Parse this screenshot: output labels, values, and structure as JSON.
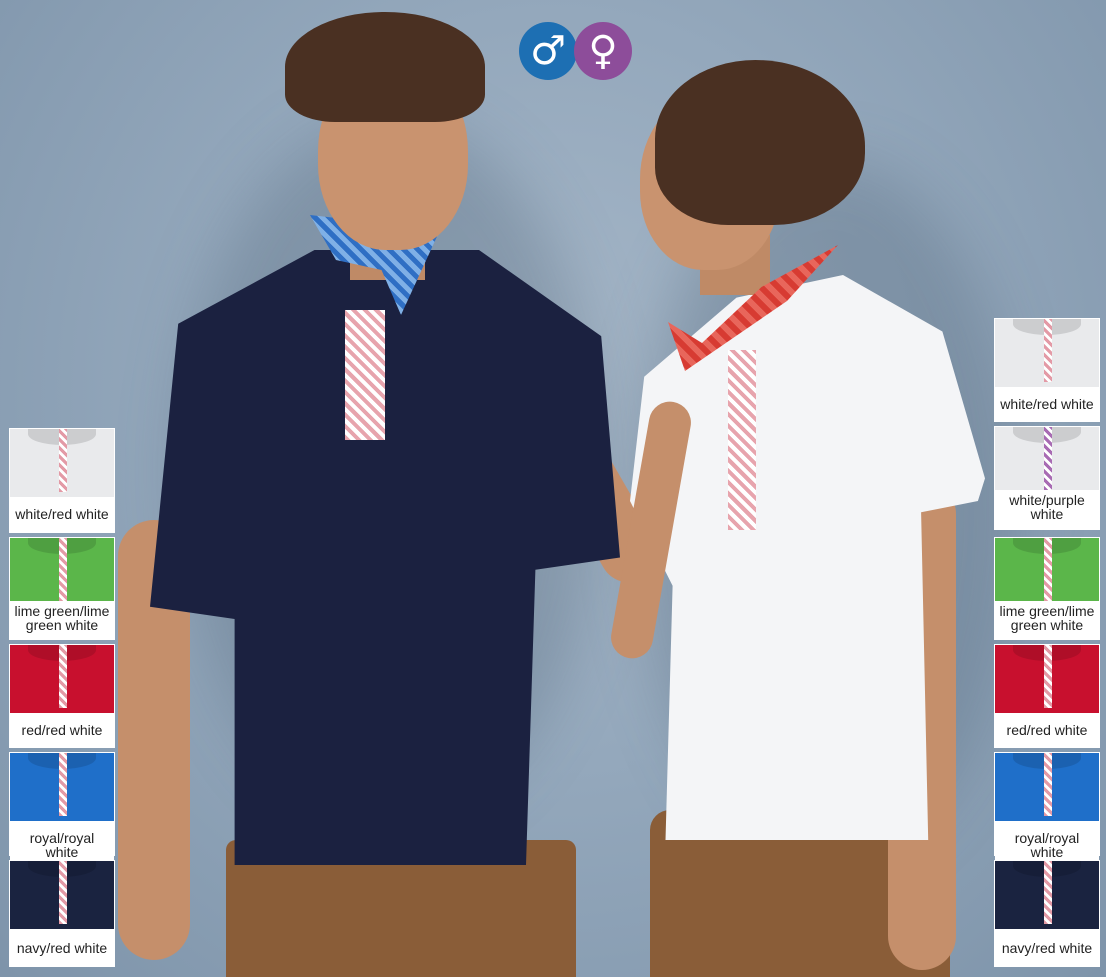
{
  "gender_icons": [
    {
      "name": "male-icon",
      "glyph": "♂",
      "color": "#1d6fb3"
    },
    {
      "name": "female-icon",
      "glyph": "♀",
      "color": "#8d4d9a"
    }
  ],
  "left_swatches": [
    {
      "label": "white/red white",
      "color": "#e9eaec"
    },
    {
      "label": "lime green/lime green white",
      "color": "#5bb64a"
    },
    {
      "label": "red/red white",
      "color": "#c8102e"
    },
    {
      "label": "royal/royal white",
      "color": "#1f6fc9"
    },
    {
      "label": "navy/red white",
      "color": "#1a2340"
    }
  ],
  "right_swatches": [
    {
      "label": "white/red white",
      "color": "#e9eaec"
    },
    {
      "label": "white/purple white",
      "color": "#e9eaec"
    },
    {
      "label": "lime green/lime green white",
      "color": "#5bb64a"
    },
    {
      "label": "red/red white",
      "color": "#c8102e"
    },
    {
      "label": "royal/royal white",
      "color": "#1f6fc9"
    },
    {
      "label": "navy/red white",
      "color": "#1a2340"
    }
  ]
}
